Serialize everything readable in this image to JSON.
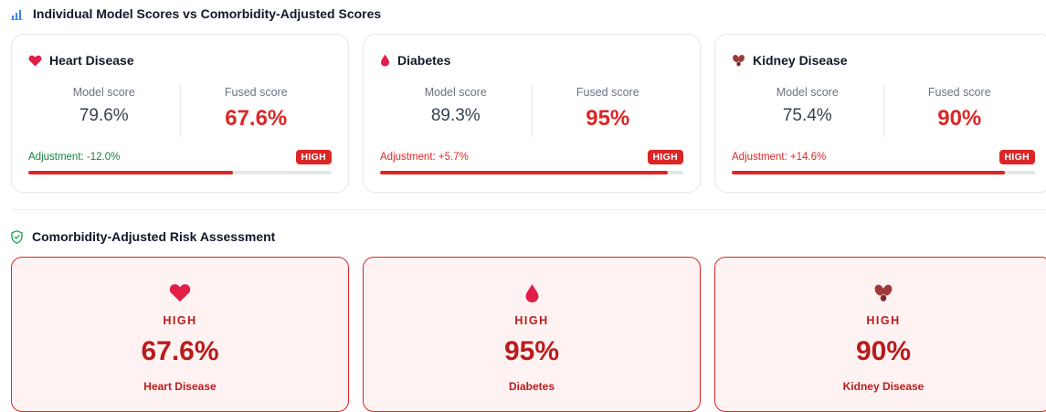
{
  "section_scores": {
    "title": "Individual Model Scores vs Comorbidity-Adjusted Scores",
    "icon": "bar-chart-icon"
  },
  "score_cards": [
    {
      "title": "Heart Disease",
      "icon": "heart-icon",
      "model_label": "Model score",
      "model_value": "79.6%",
      "fused_label": "Fused score",
      "fused_value": "67.6%",
      "adjustment": "Adjustment: -12.0%",
      "badge": "HIGH",
      "progress_percent": 67.6
    },
    {
      "title": "Diabetes",
      "icon": "drop-icon",
      "model_label": "Model score",
      "model_value": "89.3%",
      "fused_label": "Fused score",
      "fused_value": "95%",
      "adjustment": "Adjustment: +5.7%",
      "badge": "HIGH",
      "progress_percent": 95
    },
    {
      "title": "Kidney Disease",
      "icon": "kidney-icon",
      "model_label": "Model score",
      "model_value": "75.4%",
      "fused_label": "Fused score",
      "fused_value": "90%",
      "adjustment": "Adjustment: +14.6%",
      "badge": "HIGH",
      "progress_percent": 90
    }
  ],
  "section_risk": {
    "title": "Comorbidity-Adjusted Risk Assessment",
    "icon": "shield-check-icon"
  },
  "risk_cards": [
    {
      "icon": "heart-icon",
      "level": "HIGH",
      "value": "67.6%",
      "name": "Heart Disease"
    },
    {
      "icon": "drop-icon",
      "level": "HIGH",
      "value": "95%",
      "name": "Diabetes"
    },
    {
      "icon": "kidney-icon",
      "level": "HIGH",
      "value": "90%",
      "name": "Kidney Disease"
    }
  ],
  "colors": {
    "accent_red": "#dc2626",
    "adjust_negative": "#15803d",
    "risk_bg": "#fef2f2"
  }
}
